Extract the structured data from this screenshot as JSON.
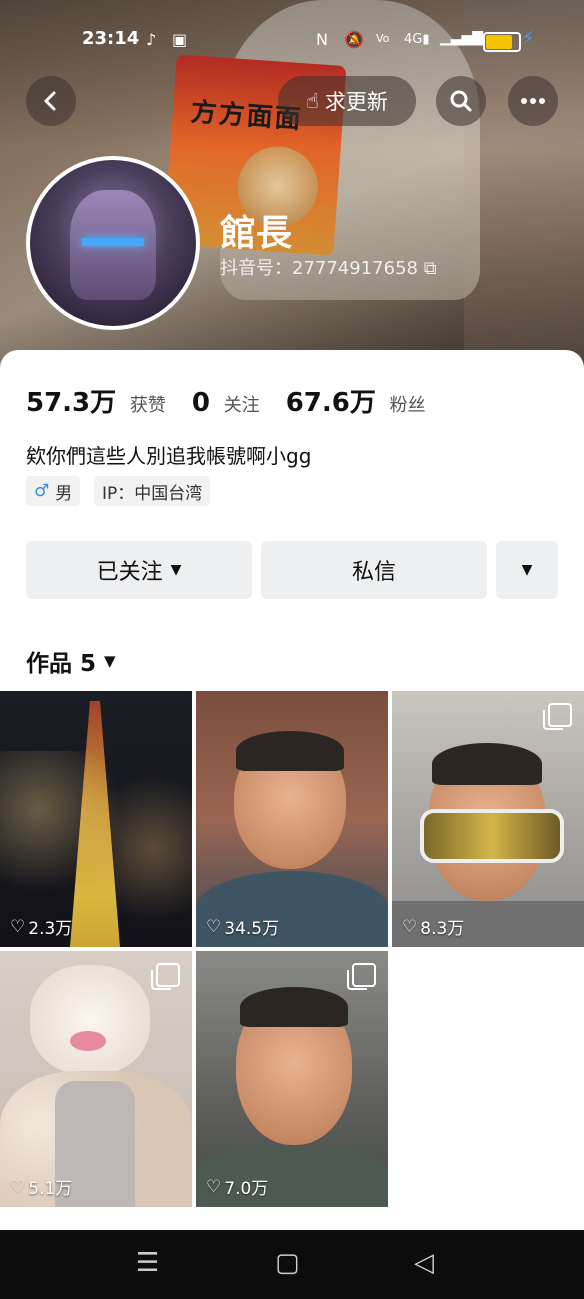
{
  "status_bar": {
    "time": "23:14",
    "icons": [
      "tiktok-icon",
      "app-icon",
      "nfc-icon",
      "mute-icon",
      "volte-icon",
      "4g-signal-icon",
      "wifi-icon",
      "battery-icon"
    ]
  },
  "header": {
    "back_icon": "chevron-left-icon",
    "request_update_label": "求更新",
    "search_icon": "search-icon",
    "more_icon": "more-icon",
    "username": "館長",
    "douyin_id": "抖音号：27774917658"
  },
  "stats": {
    "likes_value": "57.3万",
    "likes_label": "获赞",
    "following_value": "0",
    "following_label": "关注",
    "followers_value": "67.6万",
    "followers_label": "粉丝"
  },
  "bio": "欸你們這些人別追我帳號啊小gg",
  "tags": {
    "gender": "男",
    "ip": "IP：中国台湾"
  },
  "actions": {
    "followed_label": "已关注",
    "message_label": "私信"
  },
  "works": {
    "label": "作品 5"
  },
  "videos": [
    {
      "likes": "2.3万",
      "multi": false,
      "kind": "city-night"
    },
    {
      "likes": "34.5万",
      "multi": false,
      "kind": "man-car"
    },
    {
      "likes": "8.3万",
      "multi": true,
      "kind": "man-sunglasses"
    },
    {
      "likes": "5.1万",
      "multi": true,
      "kind": "muscle-cat"
    },
    {
      "likes": "7.0万",
      "multi": true,
      "kind": "man-smile"
    }
  ],
  "colors": {
    "accent_blue": "#2b8ff0",
    "battery": "#f5c400",
    "button_bg": "#eeeff1"
  }
}
